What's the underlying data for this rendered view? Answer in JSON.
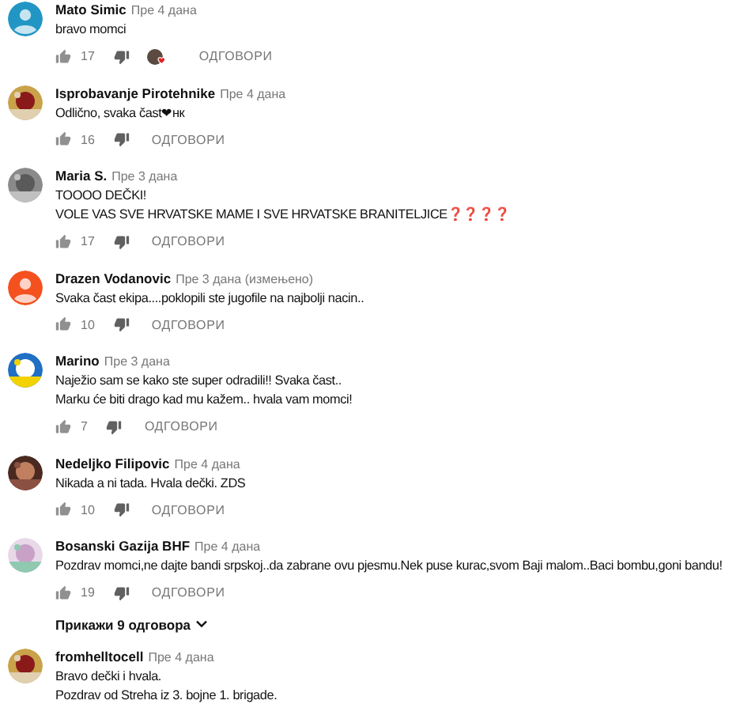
{
  "comments": [
    {
      "author": "Mato Simic",
      "time": "Пре 4 дана",
      "avatar": {
        "kind": "default",
        "color": "#2196c4"
      },
      "lines": [
        "bravo momci"
      ],
      "likes": "17",
      "creator_heart": true,
      "reply": "ОДГОВОРИ"
    },
    {
      "author": "Isprobavanje Pirotehnike",
      "time": "Пре 4 дана",
      "avatar": {
        "kind": "picture"
      },
      "lines": [
        "Odlično, svaka čast❤нк"
      ],
      "likes": "16",
      "creator_heart": false,
      "reply": "ОДГОВОРИ"
    },
    {
      "author": "Maria S.",
      "time": "Пре 3 дана",
      "avatar": {
        "kind": "picture"
      },
      "lines": [
        "TOOOO DEČKI!",
        "VOLE VAS SVE HRVATSKE MAME I SVE HRVATSKE BRANITELJICE❓❓❓❓"
      ],
      "likes": "17",
      "creator_heart": false,
      "reply": "ОДГОВОРИ"
    },
    {
      "author": "Drazen Vodanovic",
      "time": "Пре 3 дана (измењено)",
      "avatar": {
        "kind": "default",
        "color": "#f4511e"
      },
      "lines": [
        "Svaka čast ekipa....poklopili ste jugofile na najbolji nacin.."
      ],
      "likes": "10",
      "creator_heart": false,
      "reply": "ОДГОВОРИ"
    },
    {
      "author": "Marino",
      "time": "Пре 3 дана",
      "avatar": {
        "kind": "picture"
      },
      "lines": [
        "Naježio sam se kako ste super odradili!! Svaka čast..",
        "Marku će biti drago kad mu kažem.. hvala vam momci!"
      ],
      "likes": "7",
      "creator_heart": false,
      "reply": "ОДГОВОРИ"
    },
    {
      "author": "Nedeljko Filipovic",
      "time": "Пре 4 дана",
      "avatar": {
        "kind": "picture"
      },
      "lines": [
        "Nikada a ni tada. Hvala dečki. ZDS"
      ],
      "likes": "10",
      "creator_heart": false,
      "reply": "ОДГОВОРИ"
    },
    {
      "author": "Bosanski Gazija BHF",
      "time": "Пре 4 дана",
      "avatar": {
        "kind": "picture"
      },
      "lines": [
        "Pozdrav momci,ne dajte bandi srpskoj..da zabrane ovu pjesmu.Nek puse kurac,svom Baji malom..Baci bombu,goni bandu!"
      ],
      "likes": "19",
      "creator_heart": false,
      "reply": "ОДГОВОРИ",
      "show_replies": "Прикажи 9 одговора"
    },
    {
      "author": "fromhelltocell",
      "time": "Пре 4 дана",
      "avatar": {
        "kind": "picture"
      },
      "lines": [
        "Bravo dečki i hvala.",
        "Pozdrav od Streha iz 3. bojne 1. brigade."
      ]
    }
  ]
}
